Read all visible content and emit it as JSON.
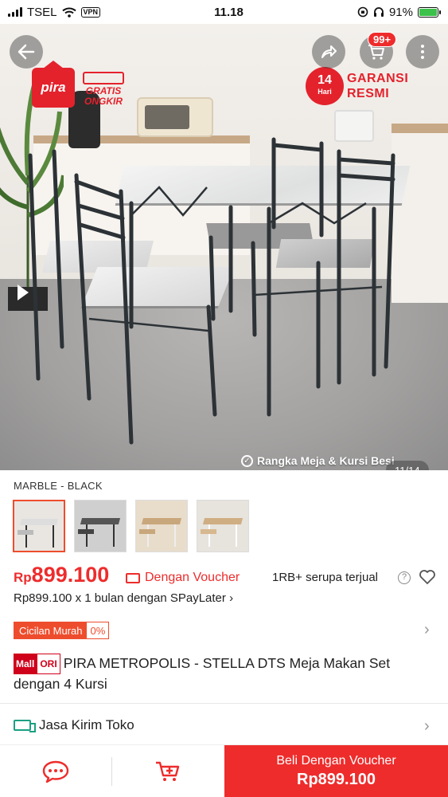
{
  "status_bar": {
    "carrier": "TSEL",
    "vpn": "VPN",
    "time": "11.18",
    "battery": "91%"
  },
  "hero": {
    "logo_text": "pira",
    "gratis_ongkir": [
      "GRATIS",
      "ONGKIR"
    ],
    "garansi_days": "14",
    "garansi_days_unit": "Hari",
    "garansi_text": [
      "GARANSI",
      "RESMI"
    ],
    "cart_badge": "99+",
    "caption": "Rangka Meja & Kursi Besi",
    "counter": "11/14"
  },
  "variant": {
    "name": "MARBLE - BLACK",
    "thumbnail_count": 4
  },
  "price": {
    "currency": "Rp",
    "amount": "899.100",
    "voucher_label": "Dengan Voucher",
    "sold_text": "1RB+ serupa terjual",
    "paylater_prefix": "Rp899.100 x 1 bulan dengan ",
    "paylater_brand": "SPayLater"
  },
  "installment": {
    "label": "Cicilan Murah",
    "rate": "0%"
  },
  "product": {
    "mall_badge": "Mall",
    "ori_badge": "ORI",
    "title": "PIRA METROPOLIS -  STELLA DTS Meja Makan Set dengan 4 Kursi"
  },
  "shipping": {
    "label": "Jasa Kirim Toko"
  },
  "bottom_bar": {
    "buy_label": "Beli Dengan Voucher",
    "buy_price": "Rp899.100"
  },
  "colors": {
    "accent": "#ee2c2c",
    "orange": "#ee4d2d",
    "shipping": "#1aa083"
  }
}
